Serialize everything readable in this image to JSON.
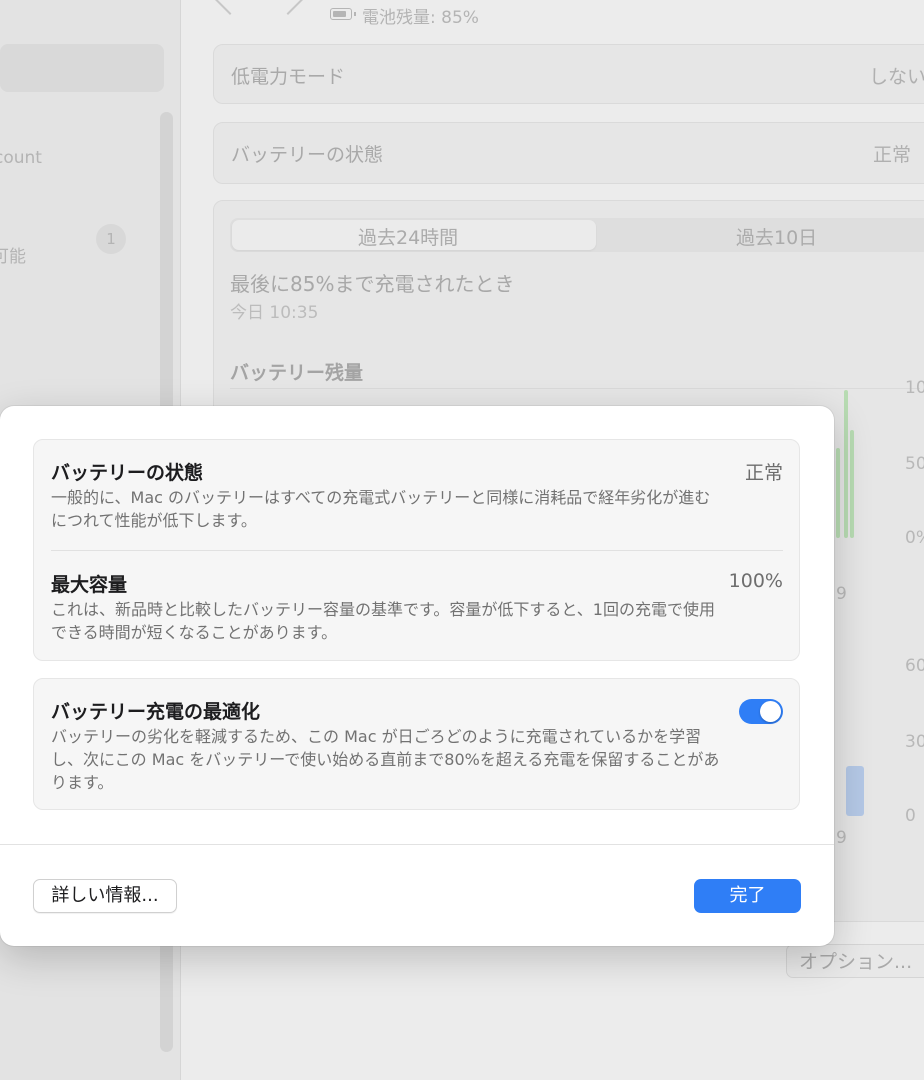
{
  "sidebar": {
    "account_fragment": "count",
    "item_fragment": "可能",
    "badge": "1"
  },
  "header": {
    "battery_icon": "battery-icon",
    "battery_level_label": "電池残量: 85%"
  },
  "rows": {
    "low_power_label": "低電力モード",
    "low_power_value": "しない",
    "health_label": "バッテリーの状態",
    "health_value": "正常"
  },
  "history": {
    "tabs": [
      "過去24時間",
      "過去10日"
    ],
    "last_charged_title": "最後に85%まで充電されたとき",
    "last_charged_time": "今日 10:35",
    "chart_title": "バッテリー残量",
    "tick_labels": [
      "10",
      "50",
      "0%",
      "9",
      "60",
      "30",
      "0",
      "9"
    ],
    "options_button": "オプション..."
  },
  "modal": {
    "battery_health": {
      "title": "バッテリーの状態",
      "value": "正常",
      "description": "一般的に、Mac のバッテリーはすべての充電式バッテリーと同様に消耗品で経年劣化が進むにつれて性能が低下します。"
    },
    "max_capacity": {
      "title": "最大容量",
      "value": "100%",
      "description": "これは、新品時と比較したバッテリー容量の基準です。容量が低下すると、1回の充電で使用できる時間が短くなることがあります。"
    },
    "optimized_charging": {
      "title": "バッテリー充電の最適化",
      "enabled": true,
      "description": "バッテリーの劣化を軽減するため、この Mac が日ごろどのように充電されているかを学習し、次にこの Mac をバッテリーで使い始める直前まで80%を超える充電を保留することがあります。"
    },
    "more_info_button": "詳しい情報...",
    "done_button": "完了"
  },
  "colors": {
    "accent": "#2f7ef6",
    "toggle_on": "#2f7ef6",
    "chart_green": "#b8dcb3",
    "chart_blue": "#b4c8e6"
  }
}
